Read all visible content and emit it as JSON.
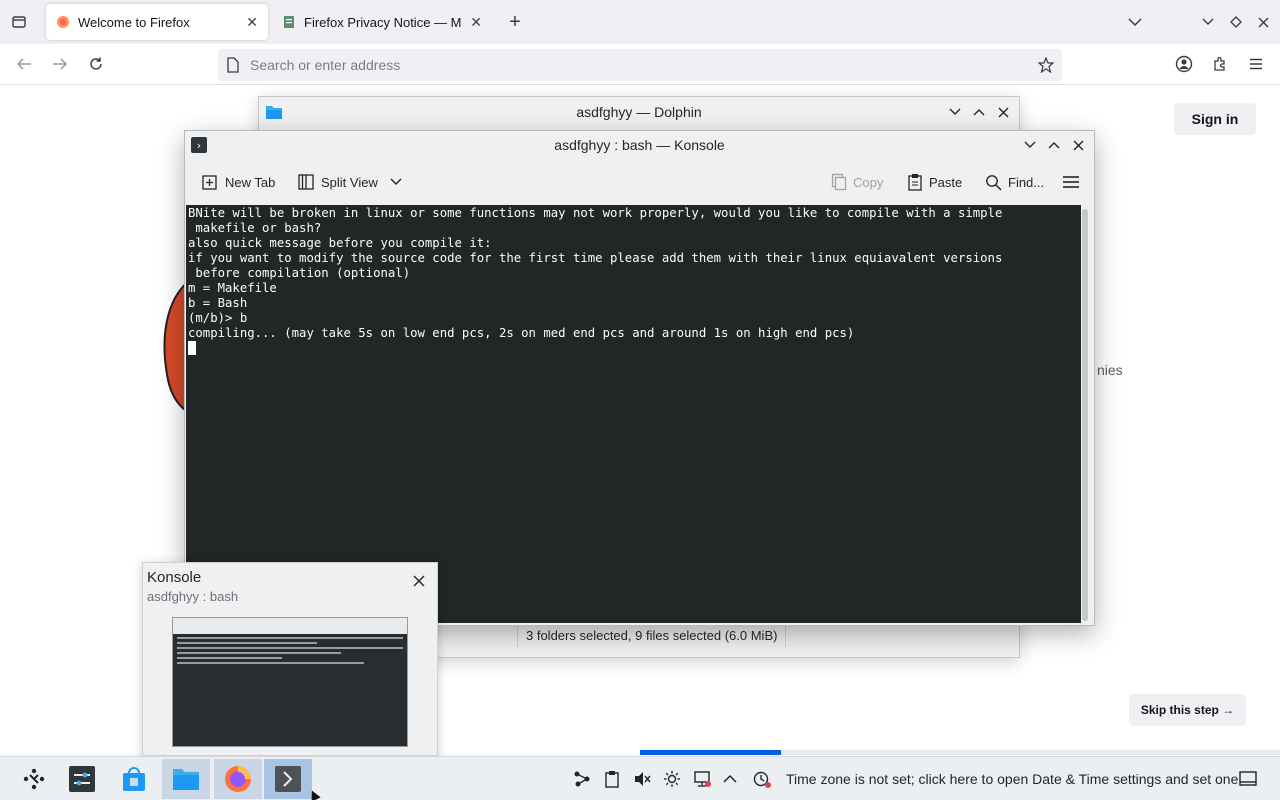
{
  "firefox": {
    "tabs": [
      {
        "title": "Welcome to Firefox",
        "active": true
      },
      {
        "title": "Firefox Privacy Notice — M",
        "active": false
      }
    ],
    "urlbar_placeholder": "Search or enter address",
    "sign_in_label": "Sign in",
    "visible_fragment": "nies",
    "skip_label": "Skip this step →",
    "progress": 0.22
  },
  "dolphin": {
    "title": "asdfghyy — Dolphin",
    "status_text": "3 folders selected, 9 files selected (6.0 MiB)"
  },
  "konsole": {
    "title": "asdfghyy : bash — Konsole",
    "toolbar": {
      "new_tab": "New Tab",
      "split_view": "Split View",
      "copy": "Copy",
      "paste": "Paste",
      "find": "Find..."
    },
    "lines": [
      "BNite will be broken in linux or some functions may not work properly, would you like to compile with a simple",
      " makefile or bash?",
      "also quick message before you compile it:",
      "if you want to modify the source code for the first time please add them with their linux equiavalent versions",
      " before compilation (optional)",
      "m = Makefile",
      "b = Bash",
      "(m/b)> b",
      "compiling... (may take 5s on low end pcs, 2s on med end pcs and around 1s on high end pcs)"
    ]
  },
  "preview": {
    "app": "Konsole",
    "subtitle": "asdfghyy : bash"
  },
  "taskbar": {
    "timezone_notice": "Time zone is not set; click here to open Date & Time settings and set one"
  }
}
